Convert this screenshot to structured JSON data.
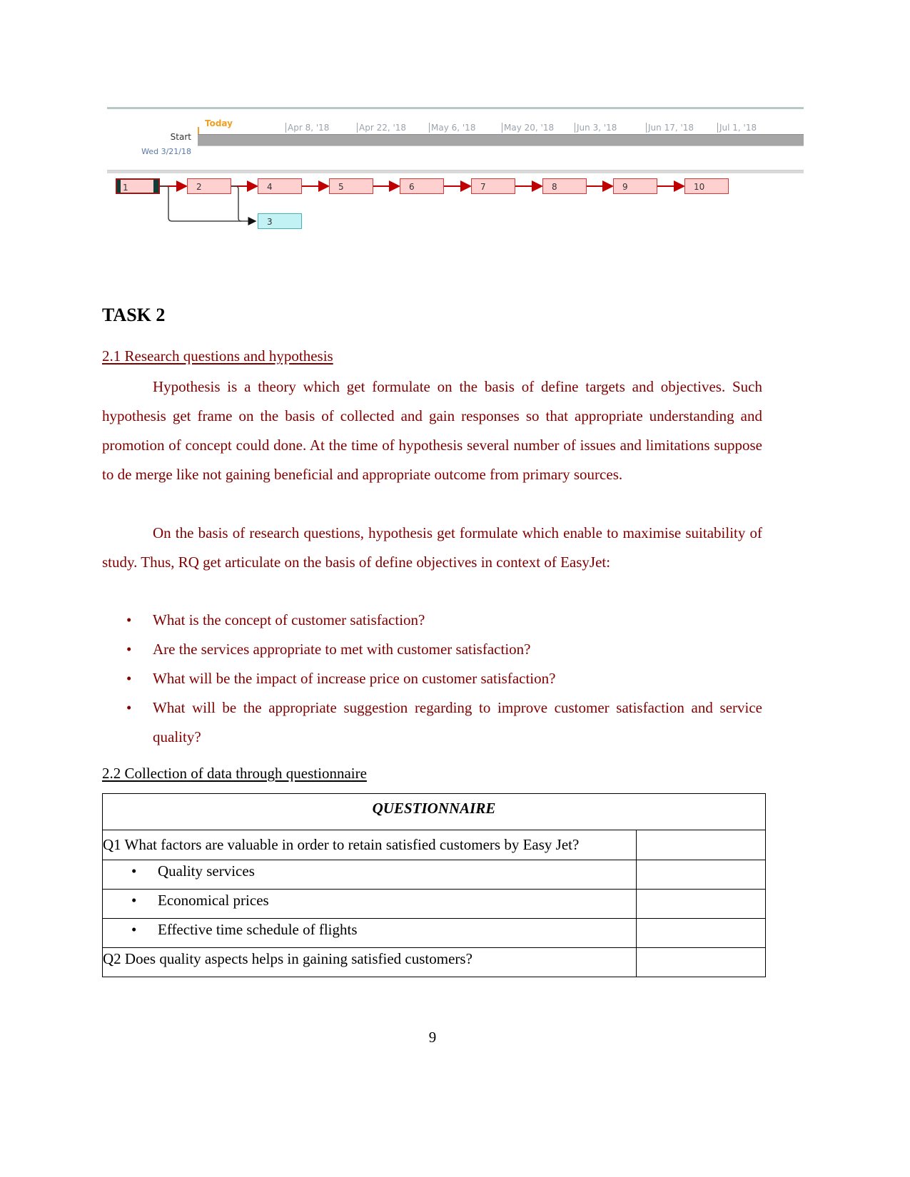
{
  "timeline": {
    "today_label": "Today",
    "start_label": "Start",
    "start_date": "Wed 3/21/18",
    "ticks": [
      "Apr 8, '18",
      "Apr 22, '18",
      "May 6, '18",
      "May 20, '18",
      "Jun 3, '18",
      "Jun 17, '18",
      "Jul 1, '18"
    ],
    "colors": {
      "today": "#f0a020",
      "bar": "#a6a6a6",
      "tick": "#9aa3ad",
      "date": "#5a77a8"
    }
  },
  "network_diagram": {
    "critical_nodes": [
      "1",
      "2",
      "4",
      "5",
      "6",
      "7",
      "8",
      "9",
      "10"
    ],
    "noncritical_nodes": [
      "3"
    ],
    "links": [
      {
        "from": "1",
        "to": "2",
        "critical": true
      },
      {
        "from": "2",
        "to": "4",
        "critical": true
      },
      {
        "from": "4",
        "to": "5",
        "critical": true
      },
      {
        "from": "5",
        "to": "6",
        "critical": true
      },
      {
        "from": "6",
        "to": "7",
        "critical": true
      },
      {
        "from": "7",
        "to": "8",
        "critical": true
      },
      {
        "from": "8",
        "to": "9",
        "critical": true
      },
      {
        "from": "9",
        "to": "10",
        "critical": true
      },
      {
        "from": "1",
        "to": "3",
        "critical": false
      },
      {
        "from": "2",
        "to": "3",
        "critical": false
      }
    ],
    "colors": {
      "critical": "#c00000",
      "critical_fill": "#ffd0d0",
      "noncritical_fill": "#c2f2f4",
      "noncritical_border": "#3cb6b8"
    }
  },
  "document": {
    "task_heading": "TASK 2",
    "section_21_heading": "2.1 Research questions and hypothesis",
    "paragraph_1": "Hypothesis is a theory which get formulate on the basis of define targets and objectives. Such hypothesis get frame on the basis of collected and gain responses so that appropriate understanding and promotion of concept could done. At the time of hypothesis several number of issues and limitations suppose to de merge like not gaining beneficial and appropriate outcome from primary sources.",
    "paragraph_2": "On the basis of research questions, hypothesis get formulate which enable to maximise suitability of study.  Thus, RQ get articulate on the basis of define objectives in context of EasyJet:",
    "bullet_glyph": "•",
    "research_questions": [
      "What is the concept of customer satisfaction?",
      "Are the services appropriate to met with customer satisfaction?",
      "What will be the impact of increase price on customer satisfaction?",
      "What will be the appropriate suggestion regarding to improve customer satisfaction and service quality?"
    ],
    "section_22_heading": "2.2 Collection of data through questionnaire",
    "text_color": "#800000",
    "page_number": "9"
  },
  "questionnaire": {
    "title": "QUESTIONNAIRE",
    "q1": "Q1 What factors are valuable in order to retain satisfied customers by Easy Jet?",
    "q1_options": [
      "Quality services",
      "Economical prices",
      "Effective time schedule of flights"
    ],
    "q2": "Q2 Does quality aspects helps in gaining satisfied customers?"
  }
}
